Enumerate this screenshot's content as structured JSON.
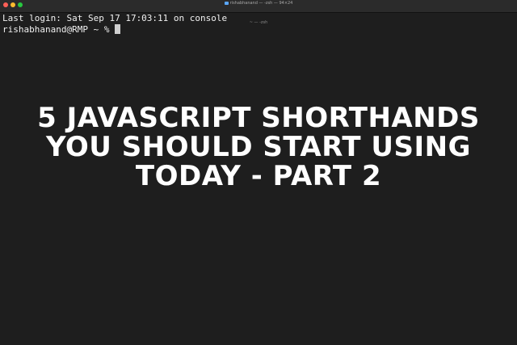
{
  "window": {
    "title": "rishabhanand — -zsh — 94×24",
    "tab_label": "~ — -zsh"
  },
  "terminal": {
    "lines": [
      "Last login: Sat Sep 17 17:03:11 on console",
      "rishabhanand@RMP ~ % "
    ]
  },
  "overlay": {
    "line1": "5 JAVASCRIPT SHORTHANDS",
    "line2": "YOU SHOULD START USING",
    "line3": "TODAY - PART 2"
  },
  "colors": {
    "background": "#1e1e1e",
    "text": "#f0f0f0",
    "title_text": "#ffffff"
  }
}
